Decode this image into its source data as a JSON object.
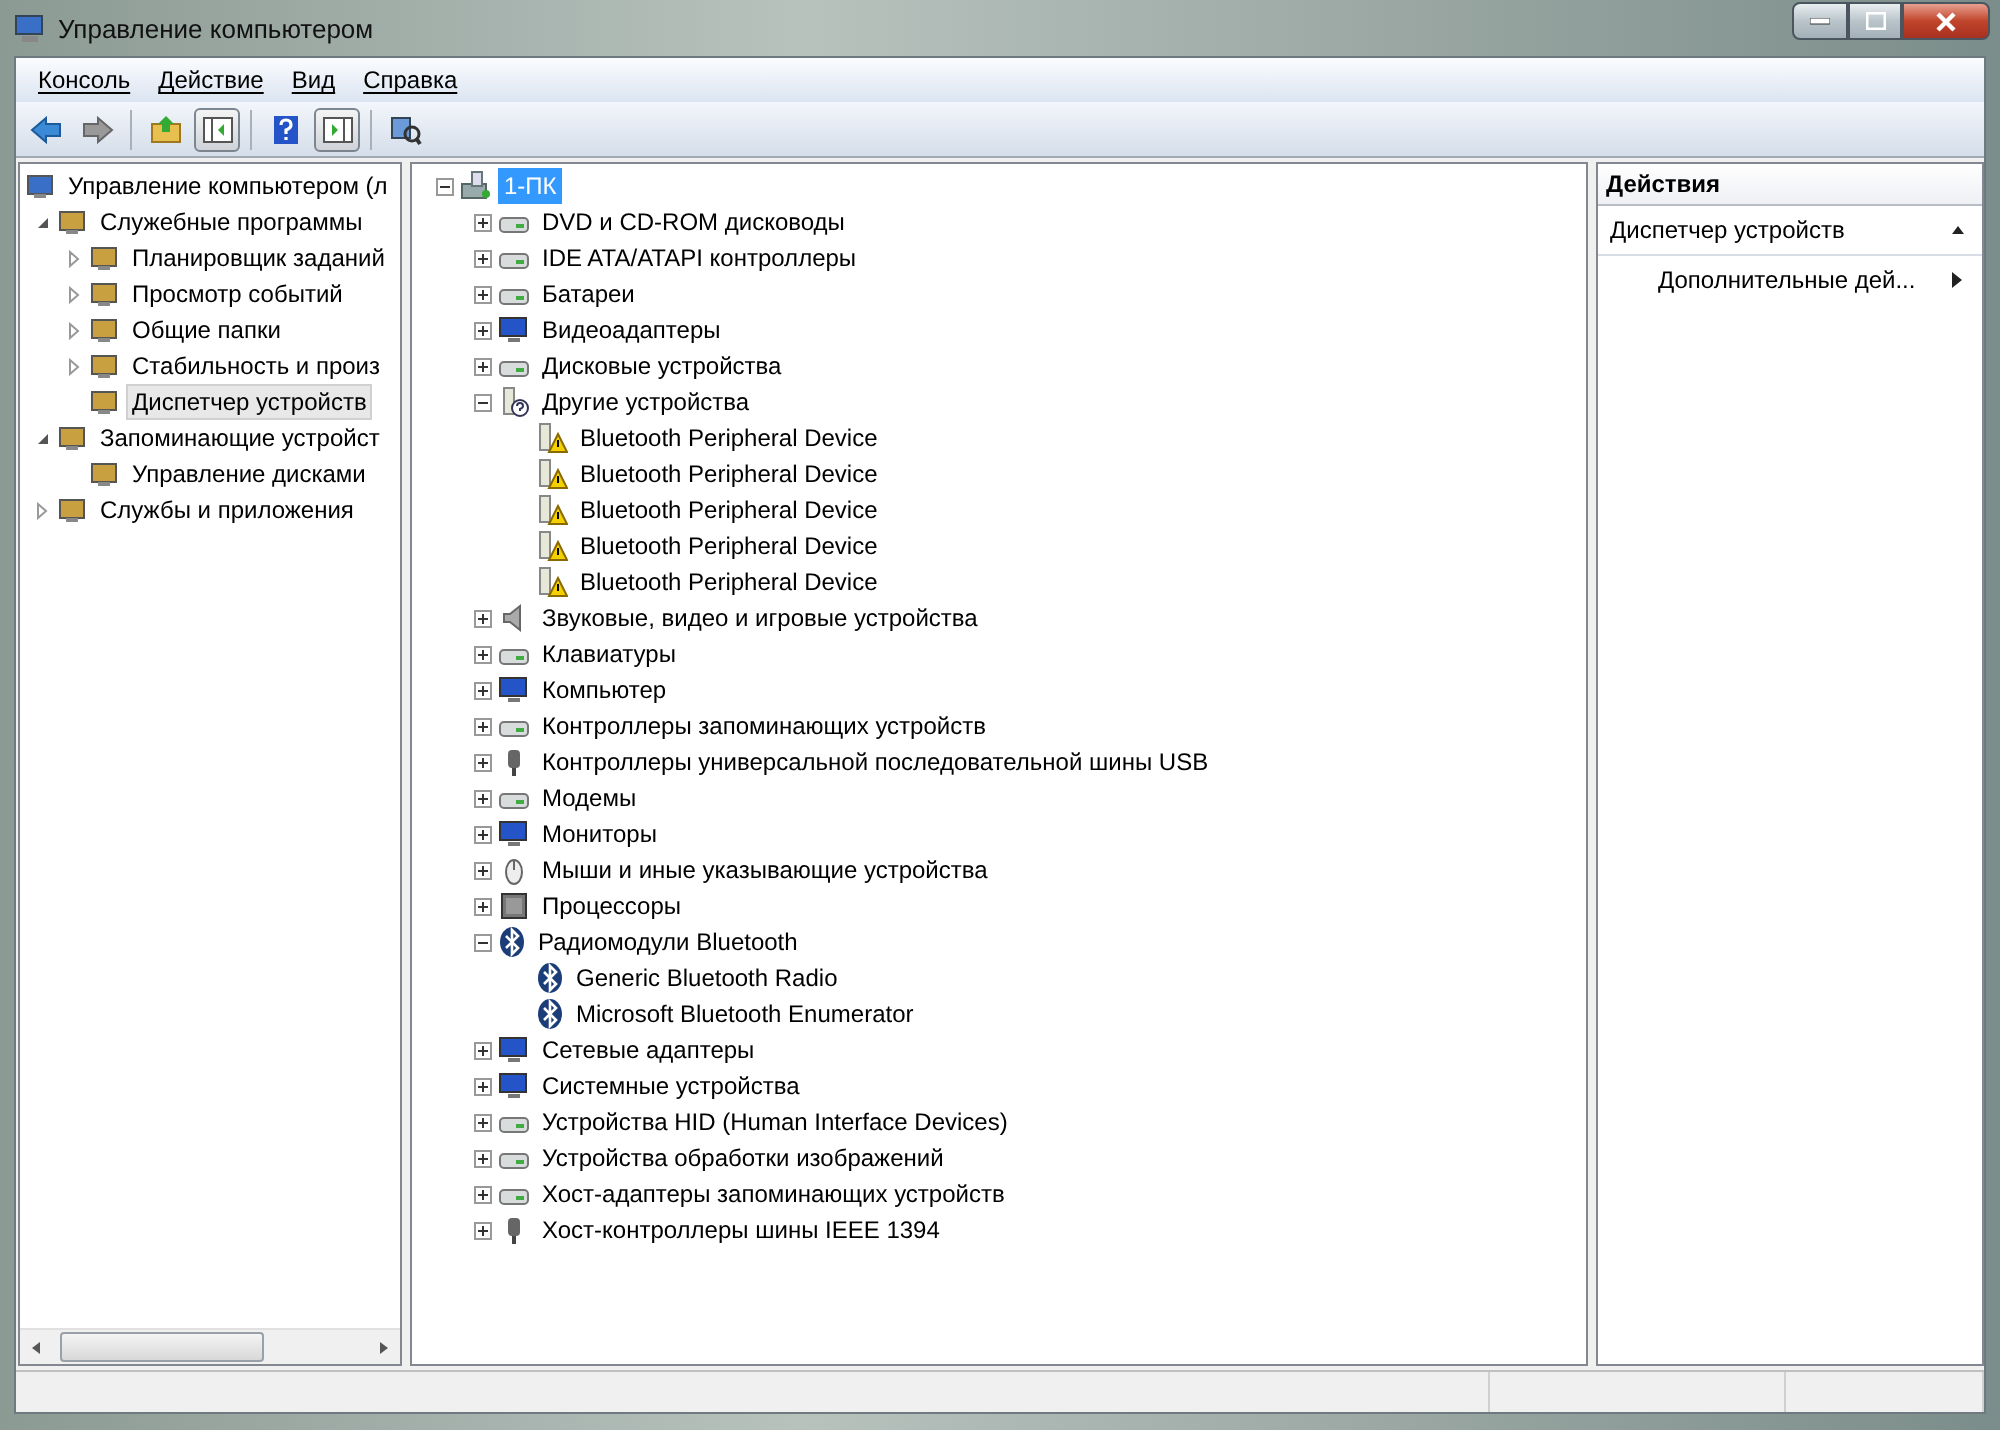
{
  "window": {
    "title": "Управление компьютером"
  },
  "menu": [
    {
      "label": "Консоль"
    },
    {
      "label": "Действие"
    },
    {
      "label": "Вид"
    },
    {
      "label": "Справка"
    }
  ],
  "toolbar": [
    {
      "kind": "back",
      "pressed": false
    },
    {
      "kind": "forward",
      "pressed": false
    },
    {
      "kind": "sep"
    },
    {
      "kind": "up",
      "pressed": false
    },
    {
      "kind": "tree",
      "pressed": true
    },
    {
      "kind": "sep"
    },
    {
      "kind": "help",
      "pressed": false
    },
    {
      "kind": "actionpane",
      "pressed": true
    },
    {
      "kind": "sep"
    },
    {
      "kind": "scan",
      "pressed": false
    }
  ],
  "navigation_tree": [
    {
      "label": "Управление компьютером (л",
      "selected": false,
      "children": [
        {
          "label": "Служебные программы",
          "selected": false,
          "expanded": true,
          "children": [
            {
              "label": "Планировщик заданий",
              "selected": false,
              "expanded": false
            },
            {
              "label": "Просмотр событий",
              "selected": false,
              "expanded": false
            },
            {
              "label": "Общие папки",
              "selected": false,
              "expanded": false
            },
            {
              "label": "Стабильность и произ",
              "selected": false,
              "expanded": false
            },
            {
              "label": "Диспетчер устройств",
              "selected": true
            }
          ]
        },
        {
          "label": "Запоминающие устройст",
          "selected": false,
          "expanded": true,
          "children": [
            {
              "label": "Управление дисками",
              "selected": false
            }
          ]
        },
        {
          "label": "Службы и приложения",
          "selected": false,
          "expanded": false
        }
      ]
    }
  ],
  "device_tree": [
    {
      "label": "1-ПК",
      "kind": "computer",
      "selected": true,
      "expanded": true,
      "children": [
        {
          "label": "DVD и CD-ROM дисководы",
          "kind": "device",
          "selected": false,
          "expanded": false
        },
        {
          "label": "IDE ATA/ATAPI контроллеры",
          "kind": "device",
          "selected": false,
          "expanded": false
        },
        {
          "label": "Батареи",
          "kind": "device",
          "selected": false,
          "expanded": false
        },
        {
          "label": "Видеоадаптеры",
          "kind": "monitor",
          "selected": false,
          "expanded": false
        },
        {
          "label": "Дисковые устройства",
          "kind": "device",
          "selected": false,
          "expanded": false
        },
        {
          "label": "Другие устройства",
          "kind": "unknown",
          "selected": false,
          "expanded": true,
          "children": [
            {
              "label": "Bluetooth Peripheral Device",
              "kind": "warning",
              "selected": false
            },
            {
              "label": "Bluetooth Peripheral Device",
              "kind": "warning",
              "selected": false
            },
            {
              "label": "Bluetooth Peripheral Device",
              "kind": "warning",
              "selected": false
            },
            {
              "label": "Bluetooth Peripheral Device",
              "kind": "warning",
              "selected": false
            },
            {
              "label": "Bluetooth Peripheral Device",
              "kind": "warning",
              "selected": false
            }
          ]
        },
        {
          "label": "Звуковые, видео и игровые устройства",
          "kind": "speaker",
          "selected": false,
          "expanded": false
        },
        {
          "label": "Клавиатуры",
          "kind": "device",
          "selected": false,
          "expanded": false
        },
        {
          "label": "Компьютер",
          "kind": "monitor",
          "selected": false,
          "expanded": false
        },
        {
          "label": "Контроллеры запоминающих устройств",
          "kind": "device",
          "selected": false,
          "expanded": false
        },
        {
          "label": "Контроллеры универсальной последовательной шины USB",
          "kind": "plug",
          "selected": false,
          "expanded": false
        },
        {
          "label": "Модемы",
          "kind": "device",
          "selected": false,
          "expanded": false
        },
        {
          "label": "Мониторы",
          "kind": "monitor",
          "selected": false,
          "expanded": false
        },
        {
          "label": "Мыши и иные указывающие устройства",
          "kind": "mouse",
          "selected": false,
          "expanded": false
        },
        {
          "label": "Процессоры",
          "kind": "chip",
          "selected": false,
          "expanded": false
        },
        {
          "label": "Радиомодули Bluetooth",
          "kind": "bluetooth",
          "selected": false,
          "expanded": true,
          "children": [
            {
              "label": "Generic Bluetooth Radio",
              "kind": "bluetooth",
              "selected": false
            },
            {
              "label": "Microsoft Bluetooth Enumerator",
              "kind": "bluetooth",
              "selected": false
            }
          ]
        },
        {
          "label": "Сетевые адаптеры",
          "kind": "monitor",
          "selected": false,
          "expanded": false
        },
        {
          "label": "Системные устройства",
          "kind": "monitor",
          "selected": false,
          "expanded": false
        },
        {
          "label": "Устройства HID (Human Interface Devices)",
          "kind": "device",
          "selected": false,
          "expanded": false
        },
        {
          "label": "Устройства обработки изображений",
          "kind": "device",
          "selected": false,
          "expanded": false
        },
        {
          "label": "Хост-адаптеры запоминающих устройств",
          "kind": "device",
          "selected": false,
          "expanded": false
        },
        {
          "label": "Хост-контроллеры шины IEEE 1394",
          "kind": "plug",
          "selected": false,
          "expanded": false
        }
      ]
    }
  ],
  "actions_pane": {
    "title": "Действия",
    "section": {
      "label": "Диспетчер устройств",
      "expanded": true
    },
    "items": [
      {
        "label": "Дополнительные дей..."
      }
    ]
  }
}
